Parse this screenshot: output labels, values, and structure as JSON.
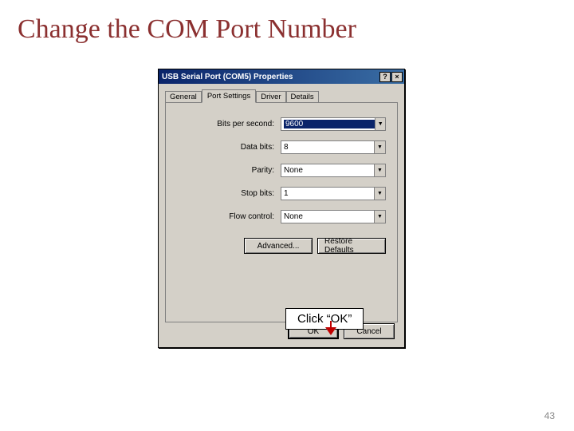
{
  "slide": {
    "title": "Change the COM Port Number",
    "page_number": "43"
  },
  "dialog": {
    "title": "USB Serial Port (COM5) Properties",
    "help_btn": "?",
    "close_btn": "×",
    "tabs": {
      "general": "General",
      "port_settings": "Port Settings",
      "driver": "Driver",
      "details": "Details"
    },
    "fields": {
      "bits_per_second": {
        "label": "Bits per second:",
        "value": "9600"
      },
      "data_bits": {
        "label": "Data bits:",
        "value": "8"
      },
      "parity": {
        "label": "Parity:",
        "value": "None"
      },
      "stop_bits": {
        "label": "Stop bits:",
        "value": "1"
      },
      "flow_control": {
        "label": "Flow control:",
        "value": "None"
      }
    },
    "buttons": {
      "advanced": "Advanced...",
      "restore": "Restore Defaults",
      "ok": "OK",
      "cancel": "Cancel"
    }
  },
  "callout": {
    "text": "Click “OK”"
  }
}
